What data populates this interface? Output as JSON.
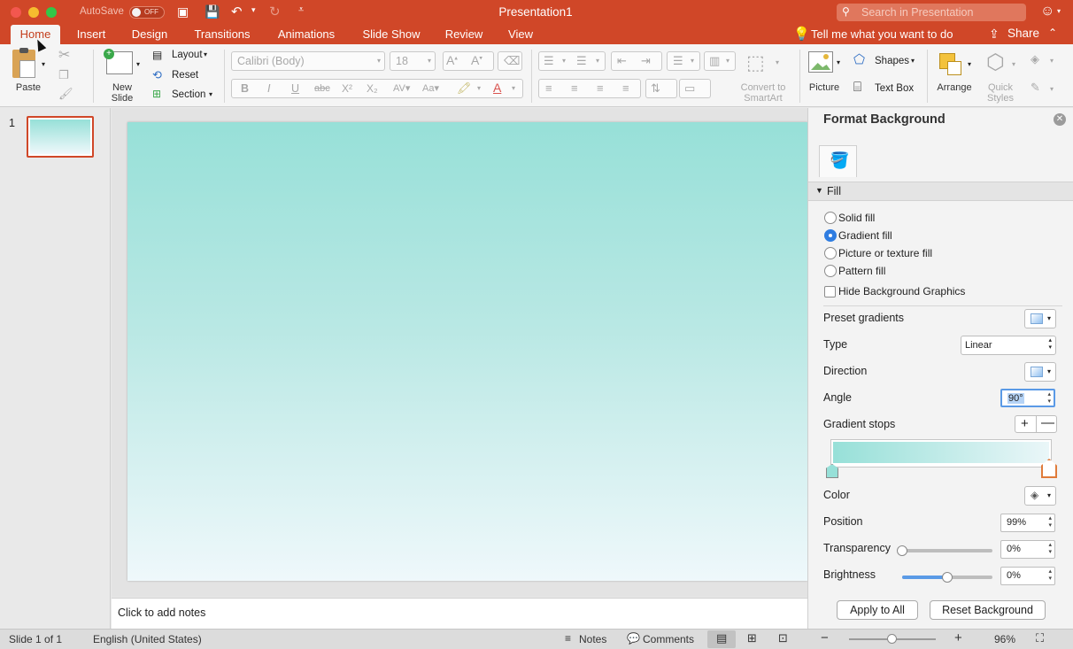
{
  "window": {
    "title": "Presentation1",
    "autosave_label": "AutoSave",
    "autosave_state": "OFF",
    "search_placeholder": "Search in Presentation"
  },
  "tabs": [
    "Home",
    "Insert",
    "Design",
    "Transitions",
    "Animations",
    "Slide Show",
    "Review",
    "View"
  ],
  "tell_me": "Tell me what you want to do",
  "share": "Share",
  "ribbon": {
    "paste": "Paste",
    "new_slide": [
      "New",
      "Slide"
    ],
    "layout": "Layout",
    "reset": "Reset",
    "section": "Section",
    "font_name": "Calibri (Body)",
    "font_size": "18",
    "convert": [
      "Convert to",
      "SmartArt"
    ],
    "picture": "Picture",
    "shapes": "Shapes",
    "text_box": "Text Box",
    "arrange": "Arrange",
    "quick_styles": [
      "Quick",
      "Styles"
    ]
  },
  "thumbnail_number": "1",
  "notes_placeholder": "Click to add notes",
  "panel": {
    "title": "Format Background",
    "section": "Fill",
    "options": [
      "Solid fill",
      "Gradient fill",
      "Picture or texture fill",
      "Pattern fill"
    ],
    "selected": "Gradient fill",
    "hide_bg": "Hide Background Graphics",
    "preset_gradients": "Preset gradients",
    "type_label": "Type",
    "type_value": "Linear",
    "direction": "Direction",
    "angle_label": "Angle",
    "angle_value": "90°",
    "gradient_stops": "Gradient stops",
    "color": "Color",
    "position_label": "Position",
    "position_value": "99%",
    "transparency_label": "Transparency",
    "transparency_value": "0%",
    "transparency_level": 0,
    "brightness_label": "Brightness",
    "brightness_value": "0%",
    "brightness_level": 0.5,
    "apply_all": "Apply to All",
    "reset_bg": "Reset Background",
    "stop_colors": [
      "#97e0d8",
      "#eaf6f8"
    ]
  },
  "status": {
    "slide": "Slide 1 of 1",
    "language": "English (United States)",
    "notes": "Notes",
    "comments": "Comments",
    "zoom": "96%"
  },
  "colors": {
    "accent": "#d04728",
    "selection": "#2f7de1"
  }
}
